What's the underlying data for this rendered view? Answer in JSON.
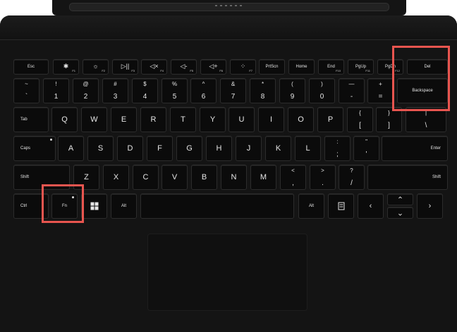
{
  "rows": {
    "function": [
      {
        "id": "esc",
        "main": "Esc"
      },
      {
        "id": "f1",
        "icon": "✱",
        "fn": "F1"
      },
      {
        "id": "f2",
        "icon": "☼",
        "fn": "F2"
      },
      {
        "id": "f3",
        "icon": "▷||",
        "fn": "F3"
      },
      {
        "id": "f4",
        "icon": "◁×",
        "fn": "F4"
      },
      {
        "id": "f5",
        "icon": "◁-",
        "fn": "F5"
      },
      {
        "id": "f6",
        "icon": "◁+",
        "fn": "F6"
      },
      {
        "id": "f7",
        "icon": "⁘",
        "fn": "F7"
      },
      {
        "id": "prtscn",
        "main": "PrtScn"
      },
      {
        "id": "home",
        "main": "Home"
      },
      {
        "id": "end",
        "main": "End",
        "fn": "F10"
      },
      {
        "id": "pgup",
        "main": "PgUp",
        "fn": "F11"
      },
      {
        "id": "pgdn",
        "main": "PgDn",
        "fn": "F12"
      },
      {
        "id": "del",
        "main": "Del"
      }
    ],
    "number": [
      {
        "id": "tilde",
        "up": "~",
        "dn": "`"
      },
      {
        "id": "n1",
        "up": "!",
        "dn": "1"
      },
      {
        "id": "n2",
        "up": "@",
        "dn": "2"
      },
      {
        "id": "n3",
        "up": "#",
        "dn": "3"
      },
      {
        "id": "n4",
        "up": "$",
        "dn": "4"
      },
      {
        "id": "n5",
        "up": "%",
        "dn": "5"
      },
      {
        "id": "n6",
        "up": "^",
        "dn": "6"
      },
      {
        "id": "n7",
        "up": "&",
        "dn": "7"
      },
      {
        "id": "n8",
        "up": "*",
        "dn": "8"
      },
      {
        "id": "n9",
        "up": "(",
        "dn": "9"
      },
      {
        "id": "n0",
        "up": ")",
        "dn": "0"
      },
      {
        "id": "minus",
        "up": "—",
        "dn": "-"
      },
      {
        "id": "equals",
        "up": "+",
        "dn": "="
      },
      {
        "id": "backspace",
        "main": "Backspace"
      }
    ],
    "qwerty": [
      {
        "id": "tab",
        "main": "Tab"
      },
      {
        "id": "q",
        "main": "Q"
      },
      {
        "id": "w",
        "main": "W"
      },
      {
        "id": "e",
        "main": "E"
      },
      {
        "id": "r",
        "main": "R"
      },
      {
        "id": "t",
        "main": "T"
      },
      {
        "id": "y",
        "main": "Y"
      },
      {
        "id": "u",
        "main": "U"
      },
      {
        "id": "i",
        "main": "I"
      },
      {
        "id": "o",
        "main": "O"
      },
      {
        "id": "p",
        "main": "P"
      },
      {
        "id": "lbrace",
        "up": "{",
        "dn": "["
      },
      {
        "id": "rbrace",
        "up": "}",
        "dn": "]"
      },
      {
        "id": "pipe",
        "up": "|",
        "dn": "\\"
      }
    ],
    "home": [
      {
        "id": "caps",
        "main": "Caps"
      },
      {
        "id": "a",
        "main": "A"
      },
      {
        "id": "s",
        "main": "S"
      },
      {
        "id": "d",
        "main": "D"
      },
      {
        "id": "f",
        "main": "F"
      },
      {
        "id": "g",
        "main": "G"
      },
      {
        "id": "h",
        "main": "H"
      },
      {
        "id": "j",
        "main": "J"
      },
      {
        "id": "k",
        "main": "K"
      },
      {
        "id": "l",
        "main": "L"
      },
      {
        "id": "semicolon",
        "up": ":",
        "dn": ";"
      },
      {
        "id": "quote",
        "up": "\"",
        "dn": "'"
      },
      {
        "id": "enter",
        "main": "Enter"
      }
    ],
    "shift": [
      {
        "id": "lshift",
        "main": "Shift"
      },
      {
        "id": "z",
        "main": "Z"
      },
      {
        "id": "x",
        "main": "X"
      },
      {
        "id": "c",
        "main": "C"
      },
      {
        "id": "v",
        "main": "V"
      },
      {
        "id": "b",
        "main": "B"
      },
      {
        "id": "n",
        "main": "N"
      },
      {
        "id": "m",
        "main": "M"
      },
      {
        "id": "comma",
        "up": "<",
        "dn": ","
      },
      {
        "id": "period",
        "up": ">",
        "dn": "."
      },
      {
        "id": "slash",
        "up": "?",
        "dn": "/"
      },
      {
        "id": "rshift",
        "main": "Shift"
      }
    ],
    "bottom": [
      {
        "id": "ctrl",
        "main": "Ctrl"
      },
      {
        "id": "fnkey",
        "main": "Fn"
      },
      {
        "id": "win",
        "icon": "windows-icon"
      },
      {
        "id": "lalt",
        "main": "Alt"
      },
      {
        "id": "space",
        "main": ""
      },
      {
        "id": "ralt",
        "main": "Alt"
      },
      {
        "id": "menu",
        "icon": "menu-icon"
      },
      {
        "id": "left",
        "main": "‹"
      },
      {
        "id": "up",
        "main": "⌃"
      },
      {
        "id": "down",
        "main": "⌄"
      },
      {
        "id": "right",
        "main": "›"
      }
    ]
  },
  "highlight_color": "#e8554f"
}
